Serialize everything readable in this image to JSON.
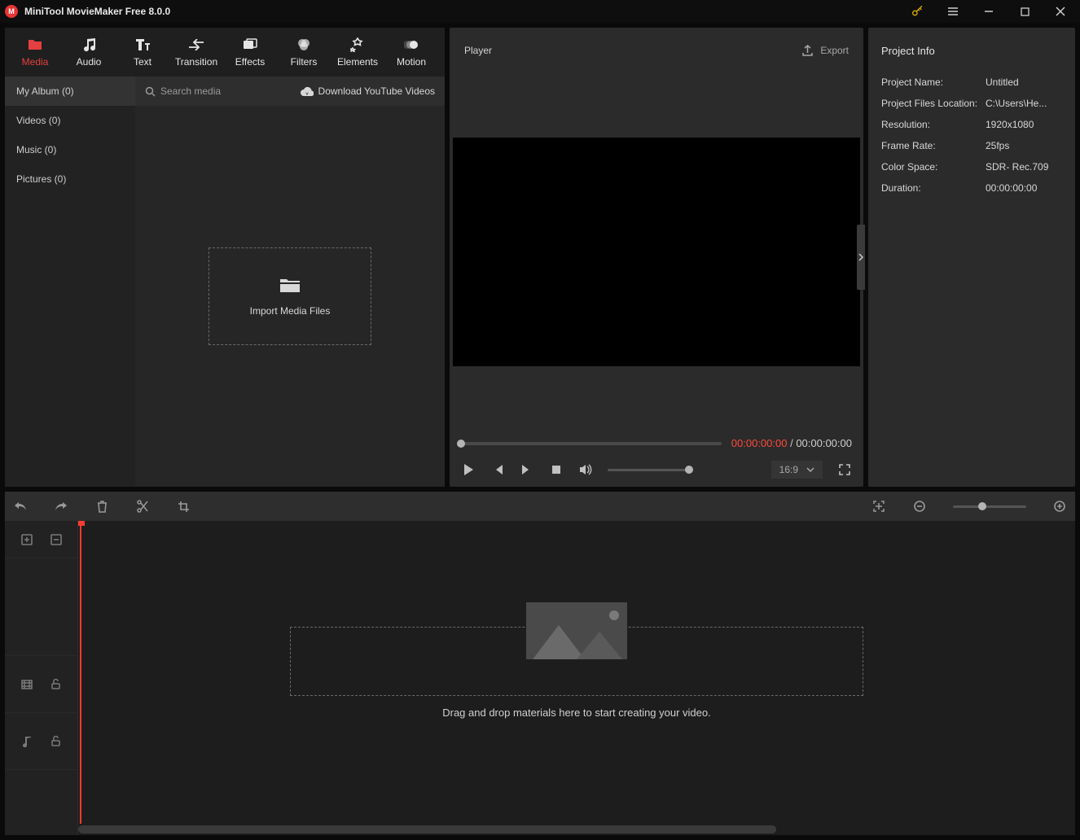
{
  "title_bar": {
    "title": "MiniTool MovieMaker Free 8.0.0"
  },
  "top_tabs": [
    {
      "label": "Media",
      "icon": "folder-icon",
      "active": true
    },
    {
      "label": "Audio",
      "icon": "music-note-icon",
      "active": false
    },
    {
      "label": "Text",
      "icon": "text-icon",
      "active": false
    },
    {
      "label": "Transition",
      "icon": "transition-icon",
      "active": false
    },
    {
      "label": "Effects",
      "icon": "effects-icon",
      "active": false
    },
    {
      "label": "Filters",
      "icon": "filters-icon",
      "active": false
    },
    {
      "label": "Elements",
      "icon": "elements-icon",
      "active": false
    },
    {
      "label": "Motion",
      "icon": "motion-icon",
      "active": false
    }
  ],
  "media_side": [
    {
      "label": "My Album (0)",
      "selected": true
    },
    {
      "label": "Videos (0)",
      "selected": false
    },
    {
      "label": "Music (0)",
      "selected": false
    },
    {
      "label": "Pictures (0)",
      "selected": false
    }
  ],
  "media_toolbar": {
    "search_placeholder": "Search media",
    "download_label": "Download YouTube Videos"
  },
  "import_box": {
    "label": "Import Media Files"
  },
  "player": {
    "title": "Player",
    "export_label": "Export",
    "current_time": "00:00:00:00",
    "separator": " / ",
    "total_time": "00:00:00:00",
    "aspect_label": "16:9"
  },
  "project_info": {
    "title": "Project Info",
    "rows": [
      {
        "k": "Project Name:",
        "v": "Untitled"
      },
      {
        "k": "Project Files Location:",
        "v": "C:\\Users\\He..."
      },
      {
        "k": "Resolution:",
        "v": "1920x1080"
      },
      {
        "k": "Frame Rate:",
        "v": "25fps"
      },
      {
        "k": "Color Space:",
        "v": "SDR- Rec.709"
      },
      {
        "k": "Duration:",
        "v": "00:00:00:00"
      }
    ]
  },
  "timeline": {
    "hint": "Drag and drop materials here to start creating your video."
  }
}
